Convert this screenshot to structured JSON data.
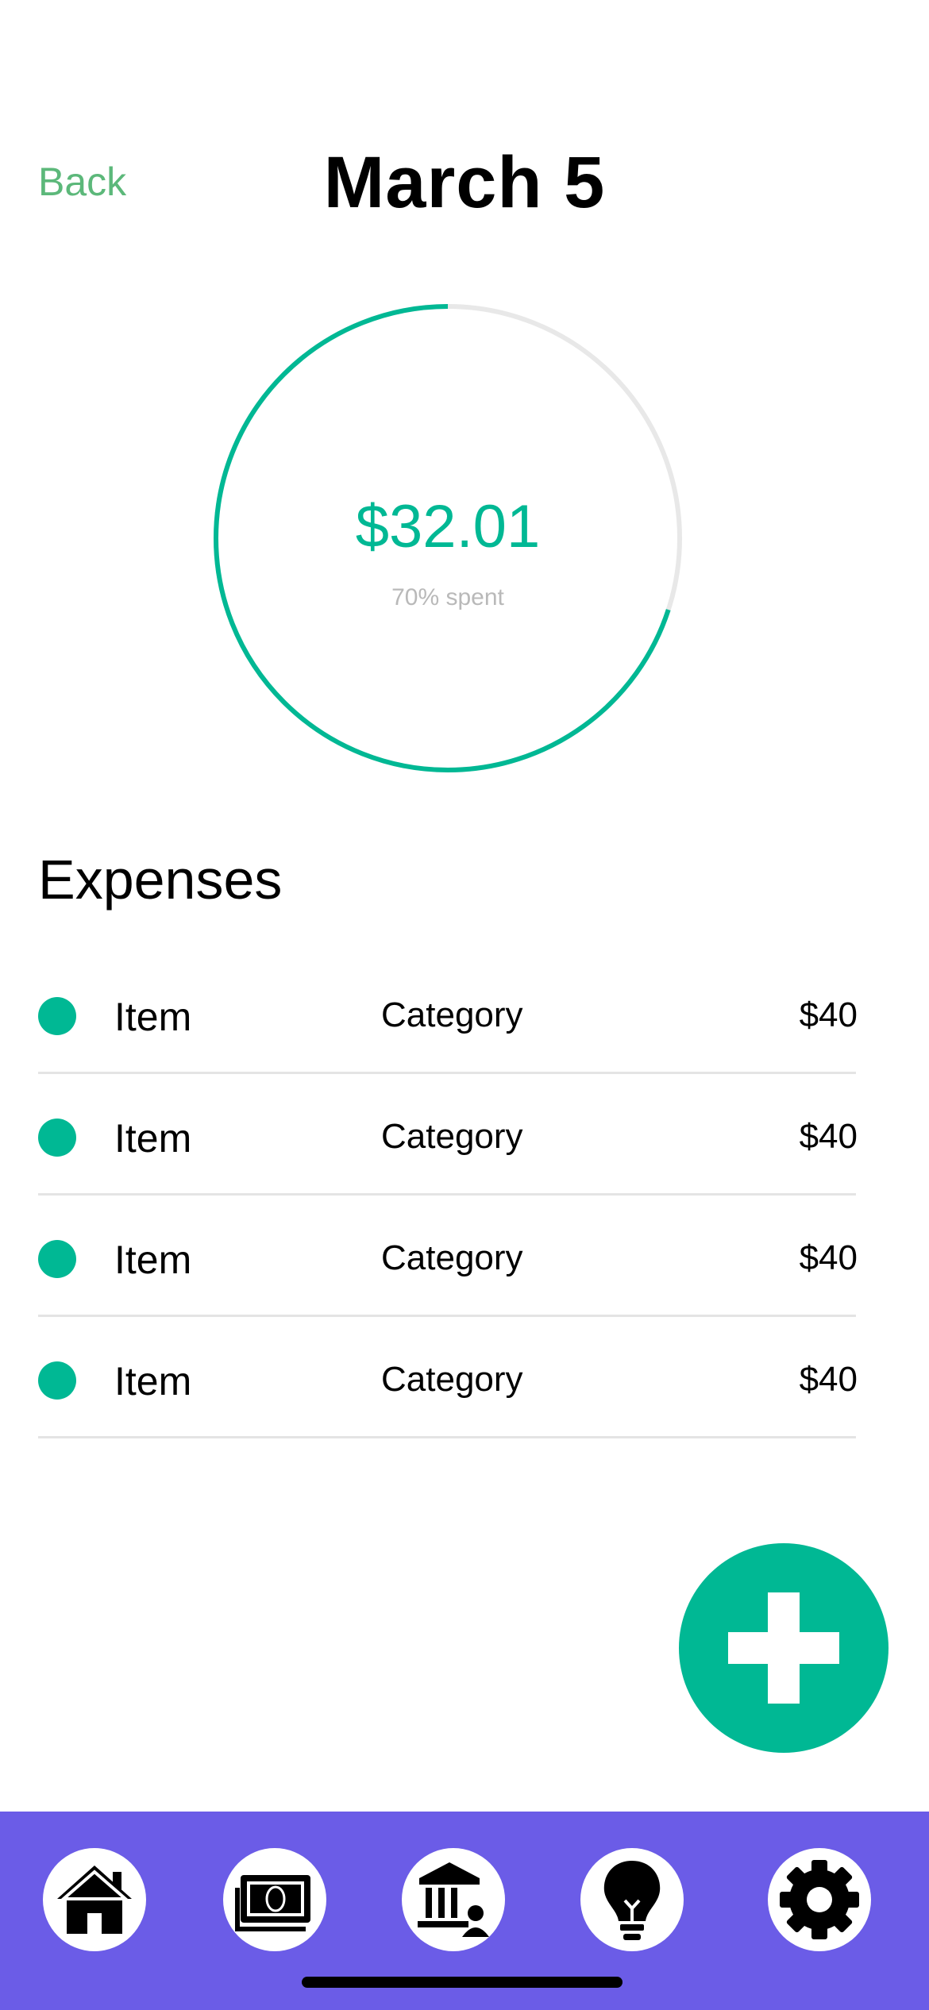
{
  "header": {
    "back_label": "Back",
    "title": "March 5"
  },
  "progress": {
    "amount": "$32.01",
    "percent_label": "70% spent",
    "fraction": 0.7,
    "colors": {
      "fill": "#00b894",
      "track": "#e8e8e8"
    }
  },
  "expenses": {
    "title": "Expenses",
    "items": [
      {
        "name": "Item",
        "category": "Category",
        "amount": "$40"
      },
      {
        "name": "Item",
        "category": "Category",
        "amount": "$40"
      },
      {
        "name": "Item",
        "category": "Category",
        "amount": "$40"
      },
      {
        "name": "Item",
        "category": "Category",
        "amount": "$40"
      }
    ]
  },
  "fab": {
    "icon": "plus-icon"
  },
  "tabbar": {
    "background": "#6b5ce7",
    "tabs": [
      {
        "icon": "home-icon"
      },
      {
        "icon": "money-icon"
      },
      {
        "icon": "bank-icon"
      },
      {
        "icon": "lightbulb-icon"
      },
      {
        "icon": "gear-icon"
      }
    ]
  },
  "colors": {
    "accent": "#00b894",
    "back_link": "#5cb87a"
  }
}
